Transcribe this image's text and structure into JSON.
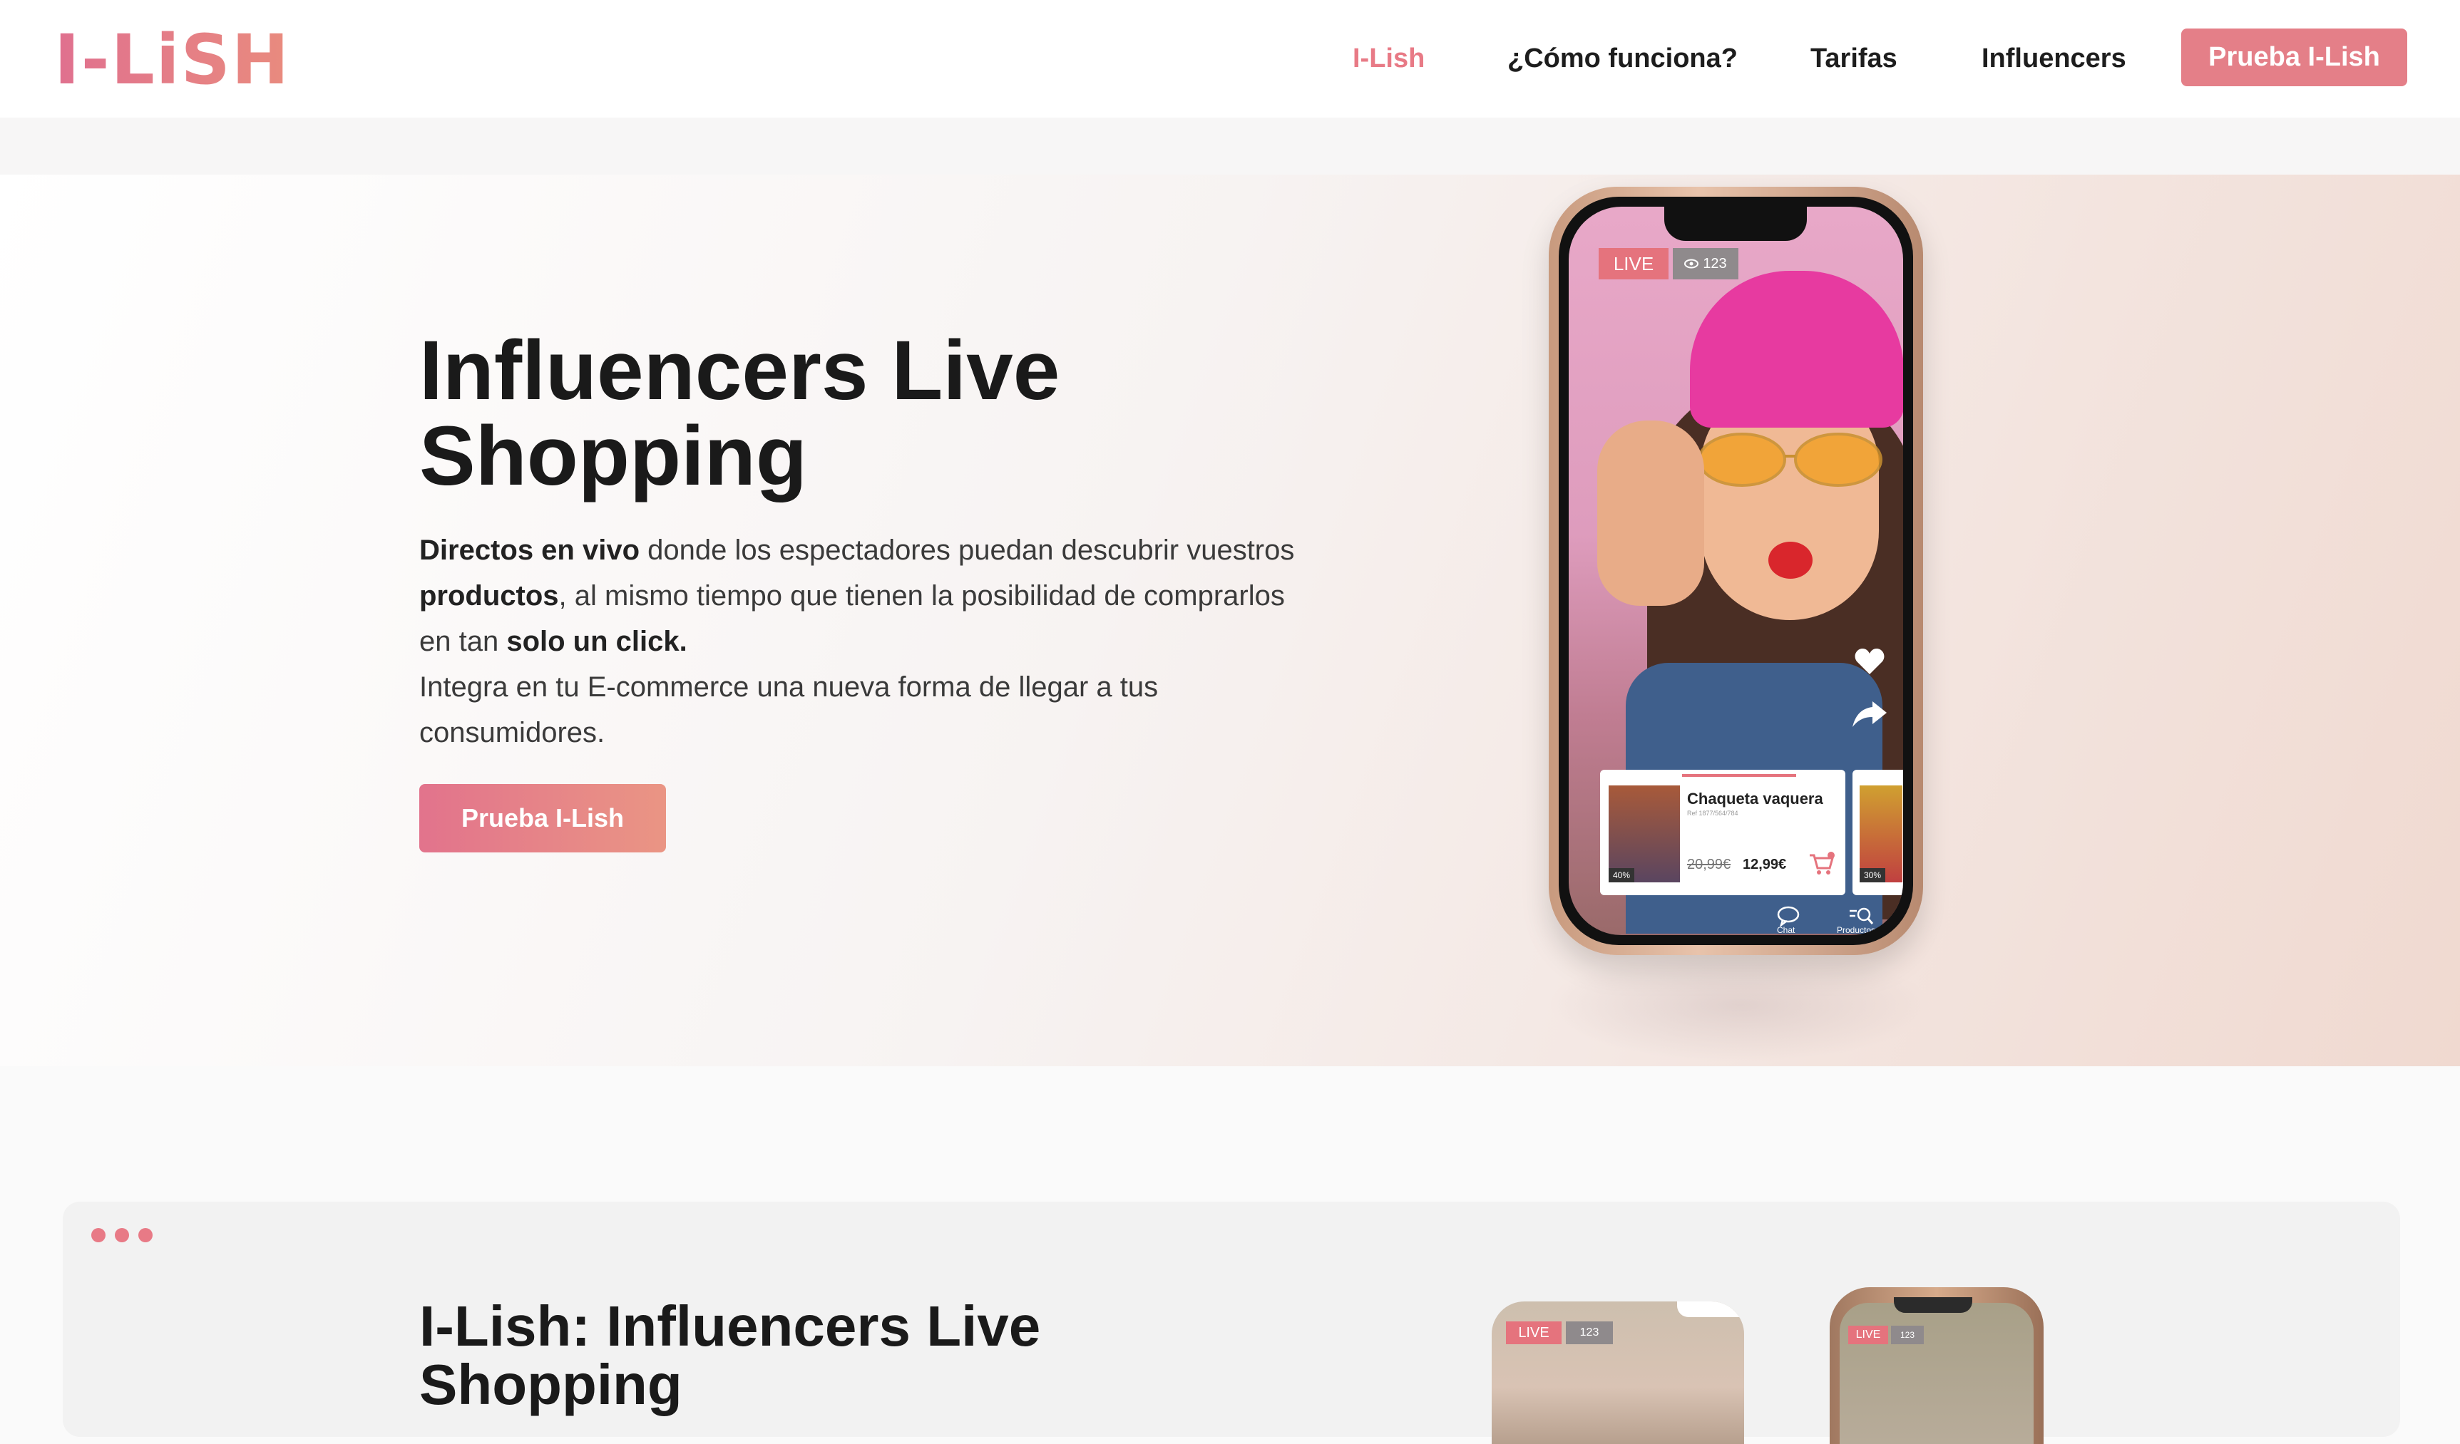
{
  "brand": {
    "logo_text": "I-LiSH",
    "accent": "#e47f88"
  },
  "nav": {
    "items": [
      {
        "label": "I-Lish",
        "active": true
      },
      {
        "label": "¿Cómo funciona?"
      },
      {
        "label": "Tarifas"
      },
      {
        "label": "Influencers"
      }
    ],
    "cta_label": "Prueba I-Lish"
  },
  "hero": {
    "title": "Influencers Live Shopping",
    "desc": {
      "p1_b1": "Directos en vivo",
      "p1_t1": " donde los espectadores puedan descubrir vuestros ",
      "p1_b2": "productos",
      "p1_t2": ", al mismo tiempo que tienen la posibilidad de comprarlos en tan ",
      "p1_b3": "solo un click.",
      "p2": "Integra en tu E-commerce una nueva forma de llegar a tus consumidores."
    },
    "cta_label": "Prueba I-Lish"
  },
  "phone": {
    "live_badge": "LIVE",
    "viewers": "123",
    "product": {
      "name": "Chaqueta vaquera",
      "ref": "Ref 1877/564/784",
      "discount": "40%",
      "price_old": "20,99€",
      "price_new": "12,99€"
    },
    "product2_discount": "30%",
    "tabs": {
      "chat": "Chat",
      "products": "Productos"
    }
  },
  "section2": {
    "title": "I-Lish: Influencers Live Shopping",
    "mini1": {
      "live": "LIVE",
      "views": "123"
    },
    "mini2": {
      "live": "LIVE",
      "views": "123"
    }
  }
}
